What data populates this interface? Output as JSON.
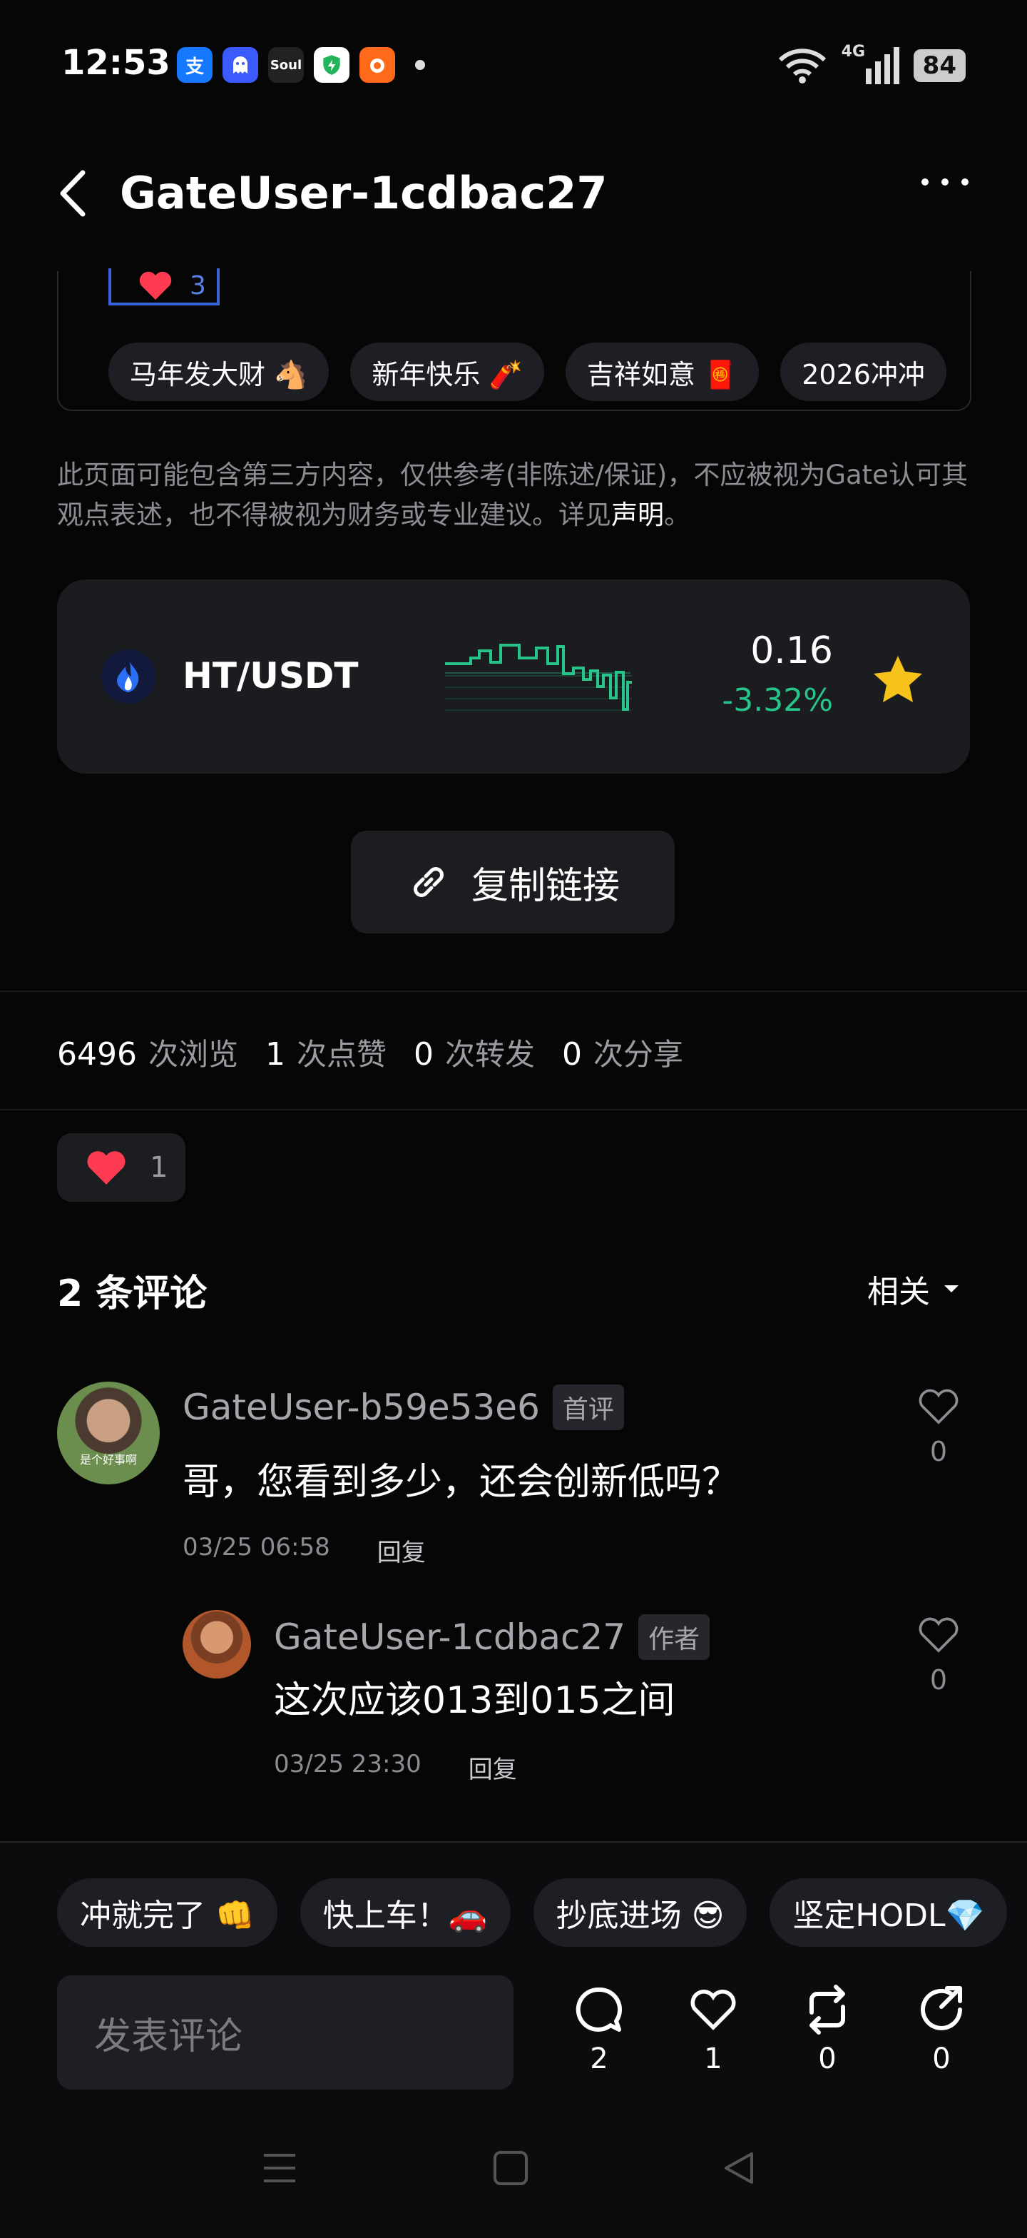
{
  "status_bar": {
    "time": "12:53",
    "network": "4G",
    "battery": "84",
    "app_icons": [
      "alipay-icon",
      "ghost-icon",
      "soul-icon",
      "shield-icon",
      "fox-icon"
    ],
    "soul_label": "Soul"
  },
  "header": {
    "title": "GateUser-1cdbac27"
  },
  "post": {
    "like_count": "3",
    "tags": [
      "马年发大财 🐴",
      "新年快乐 🧨",
      "吉祥如意 🧧",
      "2026冲冲"
    ]
  },
  "disclaimer": {
    "text": "此页面可能包含第三方内容，仅供参考(非陈述/保证)，不应被视为Gate认可其观点表述，也不得被视为财务或专业建议。详见",
    "link": "声明",
    "end": "。"
  },
  "ticker": {
    "pair": "HT/USDT",
    "price": "0.16",
    "change": "-3.32%",
    "accent": "#27c58a"
  },
  "copy_link": {
    "label": "复制链接"
  },
  "stats": {
    "views": "6496",
    "views_label": "次浏览",
    "likes": "1",
    "likes_label": "次点赞",
    "reposts": "0",
    "reposts_label": "次转发",
    "shares": "0",
    "shares_label": "次分享"
  },
  "reaction": {
    "count": "1"
  },
  "comments": {
    "title": "2 条评论",
    "sort": "相关",
    "items": [
      {
        "user": "GateUser-b59e53e6",
        "badge": "首评",
        "text": "哥，您看到多少，还会创新低吗？",
        "time": "03/25 06:58",
        "reply": "回复",
        "likes": "0",
        "avatar_caption": "是个好事啊"
      },
      {
        "user": "GateUser-1cdbac27",
        "badge": "作者",
        "text": "这次应该013到015之间",
        "time": "03/25 23:30",
        "reply": "回复",
        "likes": "0"
      }
    ]
  },
  "quick_replies": [
    "冲就完了 👊",
    "快上车！🚗",
    "抄底进场 😎",
    "坚定HODL💎"
  ],
  "composer": {
    "placeholder": "发表评论"
  },
  "actions": {
    "comments": "2",
    "likes": "1",
    "reposts": "0",
    "shares": "0"
  }
}
